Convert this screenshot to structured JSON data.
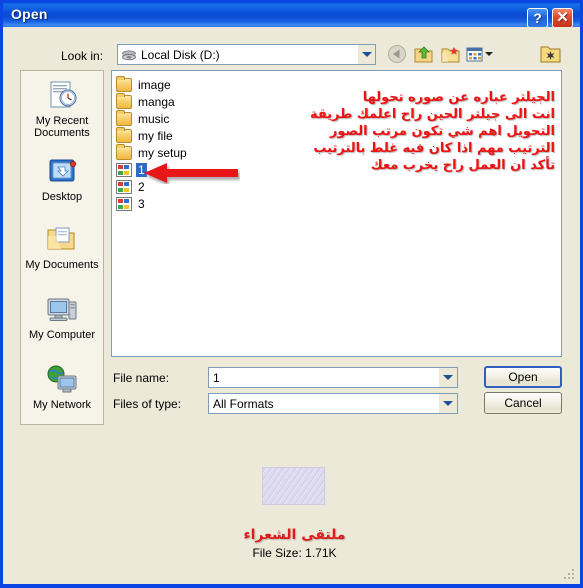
{
  "window": {
    "title": "Open",
    "help_button": "?",
    "close_button": "✕",
    "frame_color": "#0a46e4",
    "face_color": "#ece9d8"
  },
  "toolbar": {
    "lookin_label": "Look in:",
    "lookin_value": "Local Disk (D:)",
    "buttons": [
      {
        "name": "back-icon",
        "tooltip": "Back"
      },
      {
        "name": "up-one-level-icon",
        "tooltip": "Up One Level"
      },
      {
        "name": "create-new-folder-icon",
        "tooltip": "Create New Folder"
      },
      {
        "name": "views-icon",
        "tooltip": "Views"
      },
      {
        "name": "tools-folder-icon",
        "tooltip": "Tools"
      }
    ]
  },
  "places_bar": {
    "items": [
      {
        "label": "My Recent Documents",
        "icon": "recent-documents-icon"
      },
      {
        "label": "Desktop",
        "icon": "desktop-icon"
      },
      {
        "label": "My Documents",
        "icon": "my-documents-icon"
      },
      {
        "label": "My Computer",
        "icon": "my-computer-icon"
      },
      {
        "label": "My Network",
        "icon": "my-network-icon"
      }
    ]
  },
  "file_list": {
    "items": [
      {
        "name": "image",
        "type": "folder",
        "selected": false
      },
      {
        "name": "manga",
        "type": "folder",
        "selected": false
      },
      {
        "name": "music",
        "type": "folder",
        "selected": false
      },
      {
        "name": "my file",
        "type": "folder",
        "selected": false
      },
      {
        "name": "my setup",
        "type": "folder",
        "selected": false
      },
      {
        "name": "1",
        "type": "file",
        "selected": true
      },
      {
        "name": "2",
        "type": "file",
        "selected": false
      },
      {
        "name": "3",
        "type": "file",
        "selected": false
      }
    ]
  },
  "annotation": {
    "color": "#ee1111",
    "arrow": "red-left-arrow",
    "lines": [
      "الجيلتر عباره عن صوره تحولها",
      "انت الى جيلتر الحين راح اعلمك طريقة",
      "التحويل اهم شي تكون مرتب الصور",
      "الترتيب مهم اذا كان فيه غلط بالترتيب",
      "تأكد ان العمل راح يخرب معك"
    ]
  },
  "form": {
    "filename_label": "File name:",
    "filename_value": "1",
    "filetype_label": "Files of type:",
    "filetype_value": "All Formats",
    "open_button": "Open",
    "cancel_button": "Cancel"
  },
  "preview": {
    "thumbnail": "image-thumbnail",
    "watermark_text": "ملتقى الشعراء",
    "file_size_text": "File Size: 1.71K"
  }
}
